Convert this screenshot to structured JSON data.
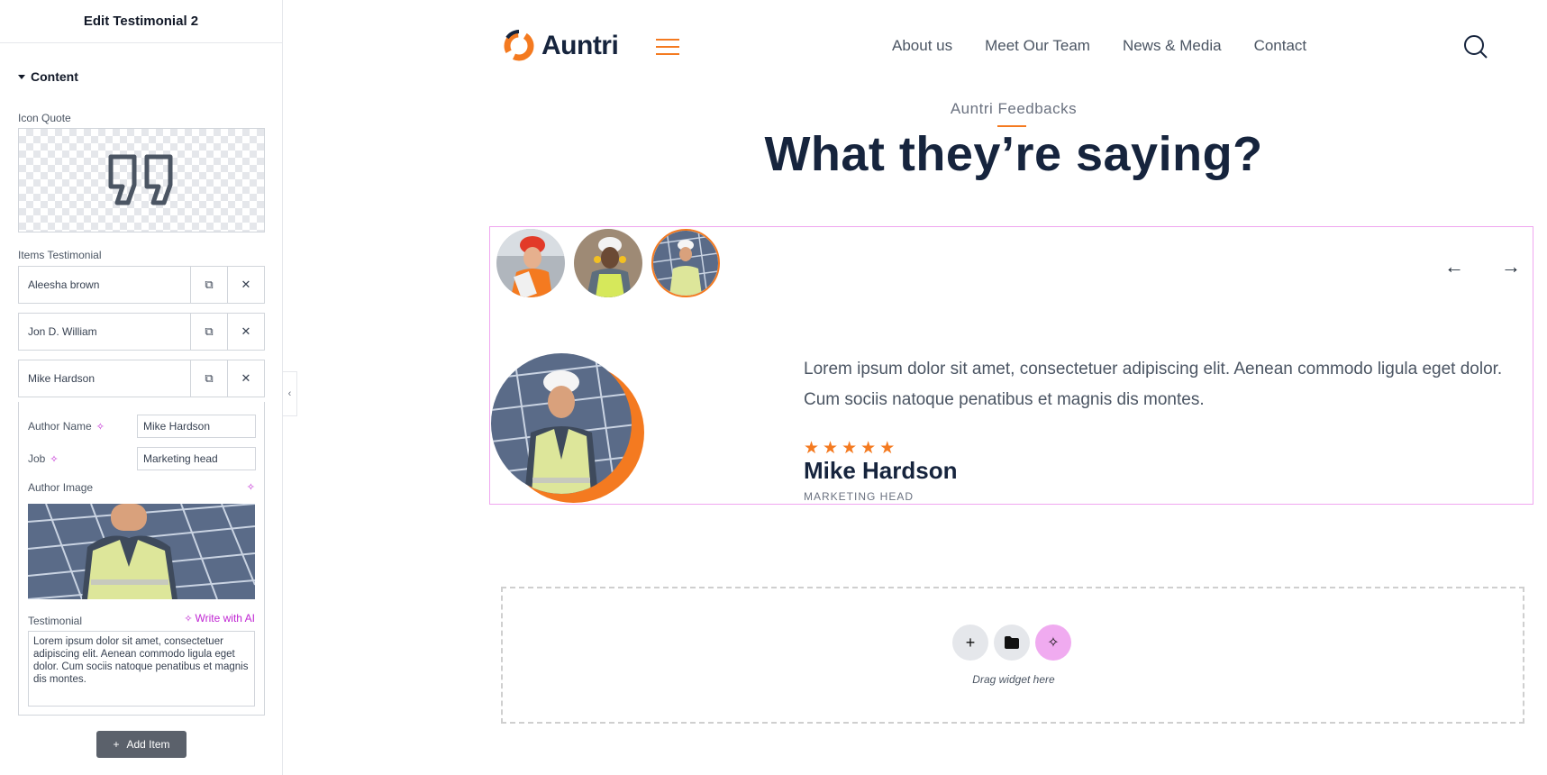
{
  "panel": {
    "title": "Edit Testimonial 2",
    "section": "Content",
    "icon_quote_label": "Icon Quote",
    "items_label": "Items Testimonial",
    "items": [
      {
        "title": "Aleesha brown"
      },
      {
        "title": "Jon D. William"
      },
      {
        "title": "Mike Hardson"
      }
    ],
    "expanded": {
      "author_name_label": "Author Name",
      "author_name_value": "Mike Hardson",
      "job_label": "Job",
      "job_value": "Marketing head",
      "author_image_label": "Author Image",
      "testimonial_label": "Testimonial",
      "write_ai": "Write with AI",
      "testimonial_text": "Lorem ipsum dolor sit amet, consectetuer adipiscing elit. Aenean commodo ligula eget dolor. Cum sociis natoque penatibus et magnis dis montes."
    },
    "add_item": "Add Item"
  },
  "site": {
    "logo": "Auntri",
    "nav": [
      "About us",
      "Meet Our Team",
      "News & Media",
      "Contact"
    ],
    "eyebrow": "Auntri Feedbacks",
    "title": "What they’re saying?",
    "testimonial": {
      "quote": "Lorem ipsum dolor sit amet, consectetuer adipiscing elit. Aenean commodo ligula eget dolor. Cum sociis natoque penatibus et magnis dis montes.",
      "stars": 5,
      "name": "Mike Hardson",
      "job": "MARKETING HEAD"
    },
    "arrows": {
      "prev": "←",
      "next": "→"
    },
    "drop_text": "Drag widget here"
  },
  "colors": {
    "accent": "#f47a20",
    "navy": "#16243d",
    "ai": "#c026d3",
    "widget_border": "#f0a6f0"
  }
}
